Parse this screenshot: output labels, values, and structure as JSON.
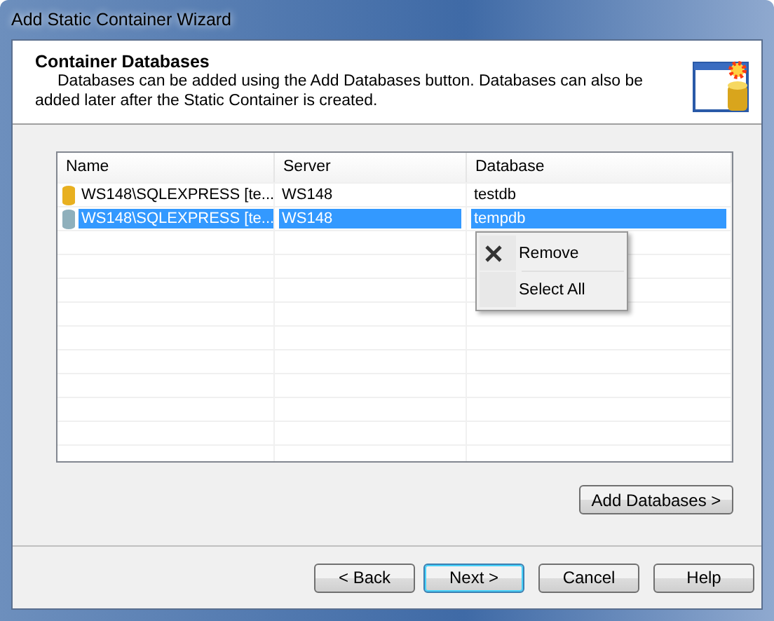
{
  "window": {
    "title": "Add Static Container Wizard"
  },
  "header": {
    "title": "Container Databases",
    "description": "Databases can be added using the Add Databases button. Databases can also be added later after the Static Container is created."
  },
  "table": {
    "columns": [
      "Name",
      "Server",
      "Database"
    ],
    "rows": [
      {
        "name": "WS148\\SQLEXPRESS [te...",
        "server": "WS148",
        "database": "testdb",
        "selected": false,
        "color": "#e8b020"
      },
      {
        "name": "WS148\\SQLEXPRESS [te...",
        "server": "WS148",
        "database": "tempdb",
        "selected": true,
        "color": "#8fb0bc"
      }
    ]
  },
  "context_menu": [
    {
      "label": "Remove",
      "kind": "close"
    },
    {
      "label": "Select All",
      "kind": "plain"
    }
  ],
  "add_button": "Add Databases  >",
  "buttons": [
    {
      "label": "< Back",
      "default": false
    },
    {
      "label": "Next >",
      "default": true
    },
    {
      "label": "Cancel",
      "default": false
    },
    {
      "label": "Help",
      "default": false
    }
  ]
}
